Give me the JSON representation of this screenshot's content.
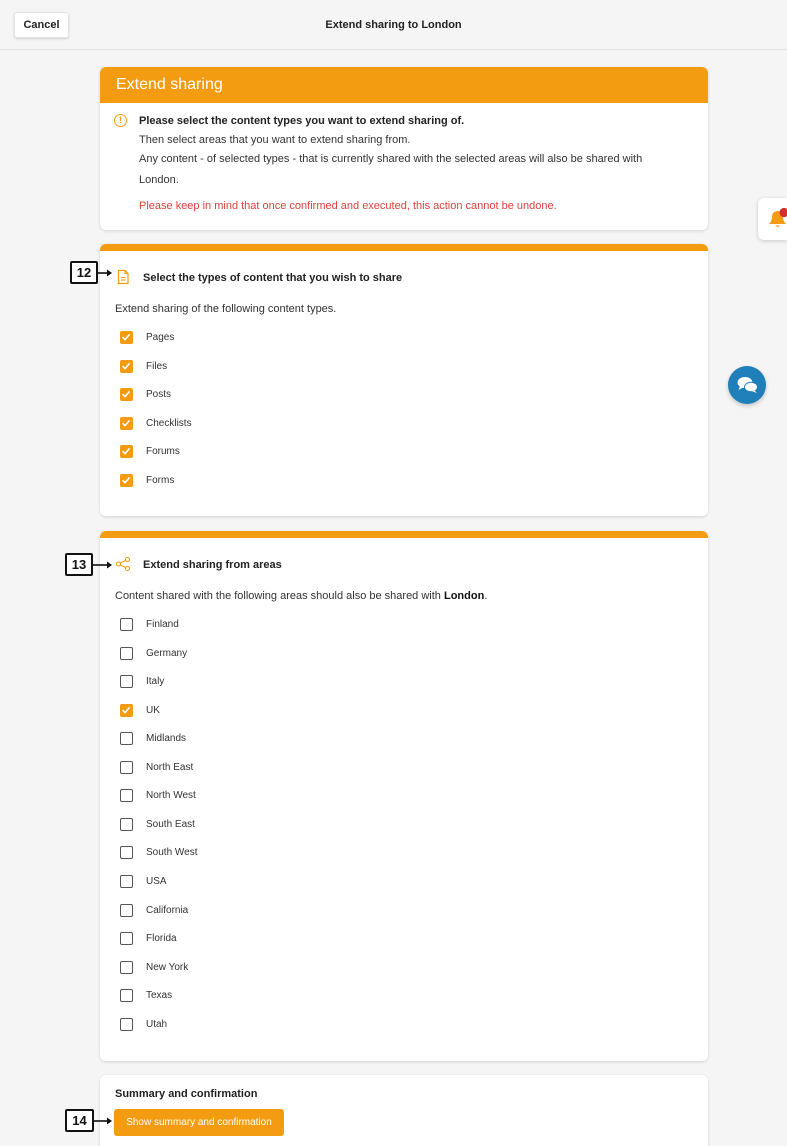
{
  "topbar": {
    "cancel_label": "Cancel",
    "title": "Extend sharing to London"
  },
  "intro": {
    "header": "Extend sharing",
    "line1": "Please select the content types you want to extend sharing of.",
    "line2": "Then select areas that you want to extend sharing from.",
    "line3": "Any content - of selected types - that is currently shared with the selected areas will also be shared with",
    "line4": "London.",
    "warning": "Please keep in mind that once confirmed and executed, this action cannot be undone."
  },
  "content_types": {
    "title": "Select the types of content that you wish to share",
    "subtitle": "Extend sharing of the following content types.",
    "items": [
      {
        "label": "Pages",
        "checked": true
      },
      {
        "label": "Files",
        "checked": true
      },
      {
        "label": "Posts",
        "checked": true
      },
      {
        "label": "Checklists",
        "checked": true
      },
      {
        "label": "Forums",
        "checked": true
      },
      {
        "label": "Forms",
        "checked": true
      }
    ]
  },
  "areas": {
    "title": "Extend sharing from areas",
    "subtitle_prefix": "Content shared with the following areas should also be shared with ",
    "subtitle_bold": "London",
    "subtitle_suffix": ".",
    "items": [
      {
        "label": "Finland",
        "checked": false
      },
      {
        "label": "Germany",
        "checked": false
      },
      {
        "label": "Italy",
        "checked": false
      },
      {
        "label": "UK",
        "checked": true
      },
      {
        "label": "Midlands",
        "checked": false
      },
      {
        "label": "North East",
        "checked": false
      },
      {
        "label": "North West",
        "checked": false
      },
      {
        "label": "South East",
        "checked": false
      },
      {
        "label": "South West",
        "checked": false
      },
      {
        "label": "USA",
        "checked": false
      },
      {
        "label": "California",
        "checked": false
      },
      {
        "label": "Florida",
        "checked": false
      },
      {
        "label": "New York",
        "checked": false
      },
      {
        "label": "Texas",
        "checked": false
      },
      {
        "label": "Utah",
        "checked": false
      }
    ]
  },
  "summary": {
    "title": "Summary and confirmation",
    "button_label": "Show summary and confirmation"
  },
  "markers": {
    "m12": "12",
    "m13": "13",
    "m14": "14"
  },
  "colors": {
    "accent": "#f39c12",
    "warning_text": "#e0413d",
    "chat": "#1f7fb8",
    "badge": "#d32f2f"
  }
}
